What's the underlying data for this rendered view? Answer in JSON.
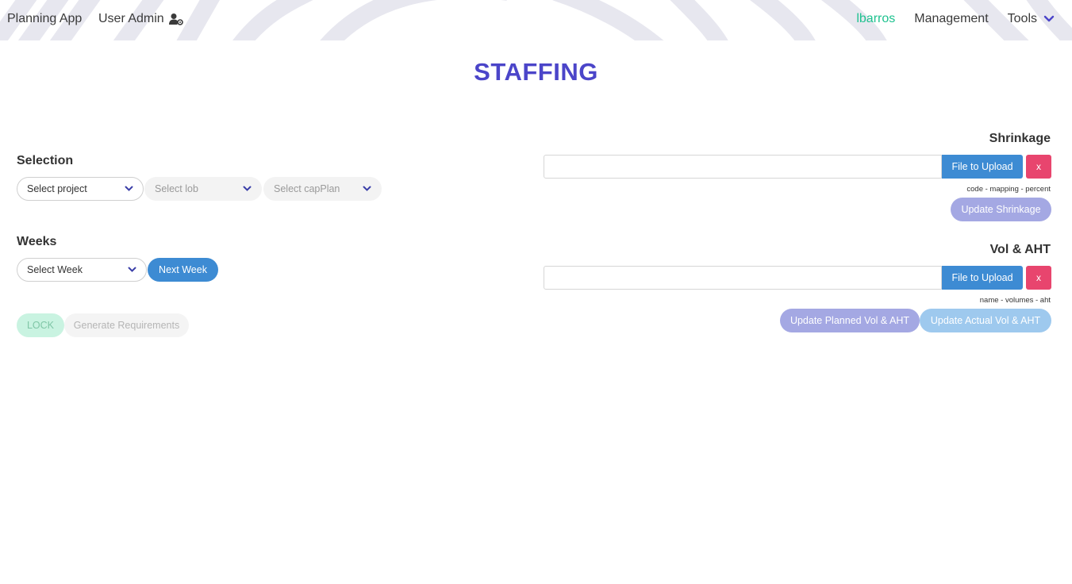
{
  "nav": {
    "brand": "Planning App",
    "user_admin": "User Admin",
    "username": "lbarros",
    "management": "Management",
    "tools": "Tools"
  },
  "page": {
    "title": "STAFFING"
  },
  "selection": {
    "label": "Selection",
    "project_placeholder": "Select project",
    "lob_placeholder": "Select lob",
    "capplan_placeholder": "Select capPlan"
  },
  "weeks": {
    "label": "Weeks",
    "week_placeholder": "Select Week",
    "next_week": "Next Week"
  },
  "actions": {
    "lock": "LOCK",
    "generate": "Generate Requirements"
  },
  "shrinkage": {
    "label": "Shrinkage",
    "upload": "File to Upload",
    "clear": "x",
    "hint": "code - mapping - percent",
    "update": "Update Shrinkage"
  },
  "vol_aht": {
    "label": "Vol & AHT",
    "upload": "File to Upload",
    "clear": "x",
    "hint": "name - volumes - aht",
    "update_planned": "Update Planned Vol & AHT",
    "update_actual": "Update Actual Vol & AHT"
  },
  "colors": {
    "accent": "#4b45c9",
    "primary_button": "#3d8bd3",
    "danger": "#e8456e",
    "user_green": "#1ec28f"
  },
  "icons": {
    "user_admin": "user-cog-icon",
    "dropdown": "chevron-down-icon"
  }
}
